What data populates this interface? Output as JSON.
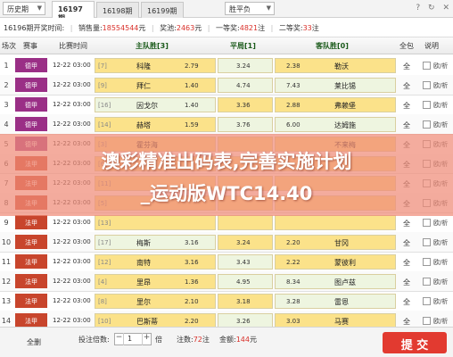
{
  "topbar": {
    "history": "历史期",
    "tabs": [
      "16197期",
      "16198期",
      "16199期"
    ],
    "play_select": "胜平负",
    "icons": [
      "question-icon",
      "refresh-icon",
      "close-icon"
    ]
  },
  "info": {
    "issue_prefix": "16196期开奖时间:",
    "sales_label": "销售量:",
    "sales_value": "18554544",
    "sales_unit": "元",
    "jackpot_label": "奖池:",
    "jackpot_value": "2463",
    "jackpot_unit": "元",
    "win_label": "一等奖:",
    "win_value": "4821",
    "win_unit": "注",
    "second_label": "二等奖:",
    "second_value": "33",
    "second_unit": "注"
  },
  "columns": {
    "no": "场次",
    "league": "赛事",
    "time": "比赛时间",
    "home": "主队胜[3]",
    "draw": "平局[1]",
    "away": "客队胜[0]",
    "all": "全包",
    "note": "说明"
  },
  "rows": [
    {
      "no": "1",
      "league": "德甲",
      "color": "#9a2f86",
      "time": "12-22 03:00",
      "hrank": "[7]",
      "home": "科隆",
      "hodd": "2.79",
      "draw": "3.24",
      "away": "勒沃",
      "aodd": "2.38",
      "all": "全",
      "note": "欧/析",
      "h": "yel",
      "d": "grn",
      "a": "yel"
    },
    {
      "no": "2",
      "league": "德甲",
      "color": "#9a2f86",
      "time": "12-22 03:00",
      "hrank": "[9]",
      "home": "拜仁",
      "hodd": "1.40",
      "draw": "4.74",
      "away": "莱比锡",
      "aodd": "7.43",
      "all": "全",
      "note": "欧/析",
      "h": "yel",
      "d": "grn",
      "a": "grn"
    },
    {
      "no": "3",
      "league": "德甲",
      "color": "#9a2f86",
      "time": "12-22 03:00",
      "hrank": "[16]",
      "home": "因戈尔",
      "hodd": "1.40",
      "draw": "3.36",
      "away": "弗赖堡",
      "aodd": "2.88",
      "all": "全",
      "note": "欧/析",
      "h": "grn",
      "d": "yel",
      "a": "yel"
    },
    {
      "no": "4",
      "league": "德甲",
      "color": "#9a2f86",
      "time": "12-22 03:00",
      "hrank": "[14]",
      "home": "赫塔",
      "hodd": "1.59",
      "draw": "3.76",
      "away": "达姆施",
      "aodd": "6.00",
      "all": "全",
      "note": "欧/析",
      "h": "yel",
      "d": "grn",
      "a": "grn"
    },
    {
      "no": "5",
      "league": "德甲",
      "color": "#9a2f86",
      "time": "12-22 03:00",
      "hrank": "[3]",
      "home": "霍芬海",
      "hodd": "",
      "draw": "",
      "away": "不来梅",
      "aodd": "",
      "all": "全",
      "note": "欧/析",
      "h": "yel",
      "d": "yel",
      "a": "yel"
    },
    {
      "no": "6",
      "league": "法甲",
      "color": "#c8452c",
      "time": "12-22 03:00",
      "hrank": "[6]",
      "home": "",
      "hodd": "",
      "draw": "",
      "away": "",
      "aodd": "",
      "all": "全",
      "note": "欧/析",
      "h": "yel",
      "d": "yel",
      "a": "yel"
    },
    {
      "no": "7",
      "league": "法甲",
      "color": "#c8452c",
      "time": "12-22 03:00",
      "hrank": "[11]",
      "home": "",
      "hodd": "",
      "draw": "",
      "away": "",
      "aodd": "",
      "all": "全",
      "note": "欧/析",
      "h": "yel",
      "d": "yel",
      "a": "yel"
    },
    {
      "no": "8",
      "league": "法甲",
      "color": "#c8452c",
      "time": "12-22 03:00",
      "hrank": "[5]",
      "home": "",
      "hodd": "",
      "draw": "",
      "away": "",
      "aodd": "",
      "all": "全",
      "note": "欧/析",
      "h": "yel",
      "d": "yel",
      "a": "yel"
    },
    {
      "no": "9",
      "league": "法甲",
      "color": "#c8452c",
      "time": "12-22 03:00",
      "hrank": "[13]",
      "home": "",
      "hodd": "",
      "draw": "",
      "away": "",
      "aodd": "",
      "all": "全",
      "note": "欧/析",
      "h": "yel",
      "d": "yel",
      "a": "yel"
    },
    {
      "no": "10",
      "league": "法甲",
      "color": "#c8452c",
      "time": "12-22 03:00",
      "hrank": "[17]",
      "home": "梅斯",
      "hodd": "3.16",
      "draw": "3.24",
      "away": "甘冈",
      "aodd": "2.20",
      "all": "全",
      "note": "欧/析",
      "h": "grn",
      "d": "yel",
      "a": "yel"
    },
    {
      "no": "11",
      "league": "法甲",
      "color": "#c8452c",
      "time": "12-22 03:00",
      "hrank": "[12]",
      "home": "南特",
      "hodd": "3.16",
      "draw": "3.43",
      "away": "蒙彼利",
      "aodd": "2.22",
      "all": "全",
      "note": "欧/析",
      "h": "yel",
      "d": "grn",
      "a": "yel"
    },
    {
      "no": "12",
      "league": "法甲",
      "color": "#c8452c",
      "time": "12-22 03:00",
      "hrank": "[4]",
      "home": "里昂",
      "hodd": "1.36",
      "draw": "4.95",
      "away": "图卢兹",
      "aodd": "8.34",
      "all": "全",
      "note": "欧/析",
      "h": "yel",
      "d": "grn",
      "a": "grn"
    },
    {
      "no": "13",
      "league": "法甲",
      "color": "#c8452c",
      "time": "12-22 03:00",
      "hrank": "[8]",
      "home": "里尔",
      "hodd": "2.10",
      "draw": "3.18",
      "away": "雷恩",
      "aodd": "3.28",
      "all": "全",
      "note": "欧/析",
      "h": "yel",
      "d": "yel",
      "a": "grn"
    },
    {
      "no": "14",
      "league": "法甲",
      "color": "#c8452c",
      "time": "12-22 03:00",
      "hrank": "[10]",
      "home": "巴斯蒂",
      "hodd": "2.20",
      "draw": "3.26",
      "away": "马赛",
      "aodd": "3.03",
      "all": "全",
      "note": "欧/析",
      "h": "yel",
      "d": "grn",
      "a": "yel"
    }
  ],
  "overlay": {
    "line1": "澳彩精准出码表,完善实施计划",
    "line2": "_运动版WTC14.40"
  },
  "footer": {
    "all_clear": "全删",
    "mult_label": "投注倍数:",
    "mult_value": "1",
    "mult_unit": "倍",
    "bets_label": "注数:",
    "bets_value": "72",
    "bets_unit": "注",
    "amount_label": "金额:",
    "amount_value": "144",
    "amount_unit": "元",
    "submit": "提 交"
  },
  "colors": {
    "accent": "#e23a30",
    "cell_yellow": "#fbe28a",
    "cell_green": "#eef5e0",
    "league_de": "#9a2f86",
    "league_fr": "#c8452c"
  }
}
